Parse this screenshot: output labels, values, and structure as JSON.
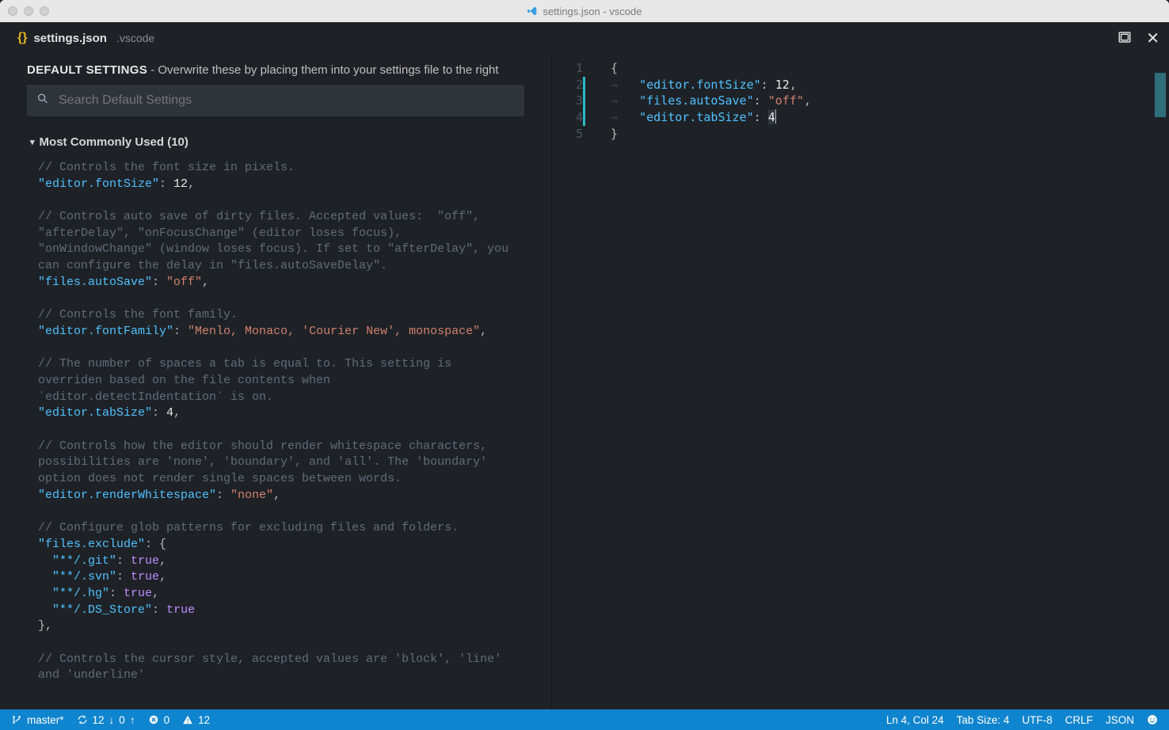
{
  "window": {
    "title": "settings.json - vscode"
  },
  "tab": {
    "filename": "settings.json",
    "folder": ".vscode"
  },
  "defaults": {
    "heading_bold": "DEFAULT SETTINGS",
    "heading_rest": " - Overwrite these by placing them into your settings file to the right",
    "search_placeholder": "Search Default Settings",
    "section_title": "Most Commonly Used (10)",
    "entries": [
      {
        "comment": "// Controls the font size in pixels.",
        "key": "\"editor.fontSize\"",
        "value": "12",
        "vtype": "num",
        "trail": ","
      },
      {
        "comment": "// Controls auto save of dirty files. Accepted values:  \"off\", \"afterDelay\", \"onFocusChange\" (editor loses focus), \"onWindowChange\" (window loses focus). If set to \"afterDelay\", you can configure the delay in \"files.autoSaveDelay\".",
        "key": "\"files.autoSave\"",
        "value": "\"off\"",
        "vtype": "str",
        "trail": ","
      },
      {
        "comment": "// Controls the font family.",
        "key": "\"editor.fontFamily\"",
        "value": "\"Menlo, Monaco, 'Courier New', monospace\"",
        "vtype": "str",
        "trail": ","
      },
      {
        "comment": "// The number of spaces a tab is equal to. This setting is overriden based on the file contents when `editor.detectIndentation` is on.",
        "key": "\"editor.tabSize\"",
        "value": "4",
        "vtype": "num",
        "trail": ","
      },
      {
        "comment": "// Controls how the editor should render whitespace characters, possibilities are 'none', 'boundary', and 'all'. The 'boundary' option does not render single spaces between words.",
        "key": "\"editor.renderWhitespace\"",
        "value": "\"none\"",
        "vtype": "str",
        "trail": ","
      },
      {
        "comment": "// Configure glob patterns for excluding files and folders.",
        "key": "\"files.exclude\"",
        "vtype": "obj",
        "obj": [
          {
            "k": "\"**/.git\"",
            "v": "true"
          },
          {
            "k": "\"**/.svn\"",
            "v": "true"
          },
          {
            "k": "\"**/.hg\"",
            "v": "true"
          },
          {
            "k": "\"**/.DS_Store\"",
            "v": "true",
            "last": true
          }
        ],
        "trail": ","
      },
      {
        "comment": "// Controls the cursor style, accepted values are 'block', 'line' and 'underline'",
        "tailonly": true
      }
    ]
  },
  "user_settings": {
    "lines": [
      {
        "n": 1,
        "raw": "{"
      },
      {
        "n": 2,
        "git": true,
        "indent": true,
        "key": "\"editor.fontSize\"",
        "val": "12",
        "vtype": "num",
        "trail": ","
      },
      {
        "n": 3,
        "git": true,
        "indent": true,
        "key": "\"files.autoSave\"",
        "val": "\"off\"",
        "vtype": "str",
        "trail": ","
      },
      {
        "n": 4,
        "git": true,
        "indent": true,
        "cursor": true,
        "key": "\"editor.tabSize\"",
        "val": "4",
        "vtype": "num",
        "trail": ""
      },
      {
        "n": 5,
        "raw": "}"
      }
    ]
  },
  "status": {
    "branch": "master*",
    "sync_down": "12",
    "sync_up": "0",
    "errors": "0",
    "warnings": "12",
    "cursor_pos": "Ln 4, Col 24",
    "tab_size": "Tab Size: 4",
    "encoding": "UTF-8",
    "eol": "CRLF",
    "language": "JSON"
  },
  "icons": {
    "split": "split-editor-icon",
    "close": "close-icon"
  }
}
